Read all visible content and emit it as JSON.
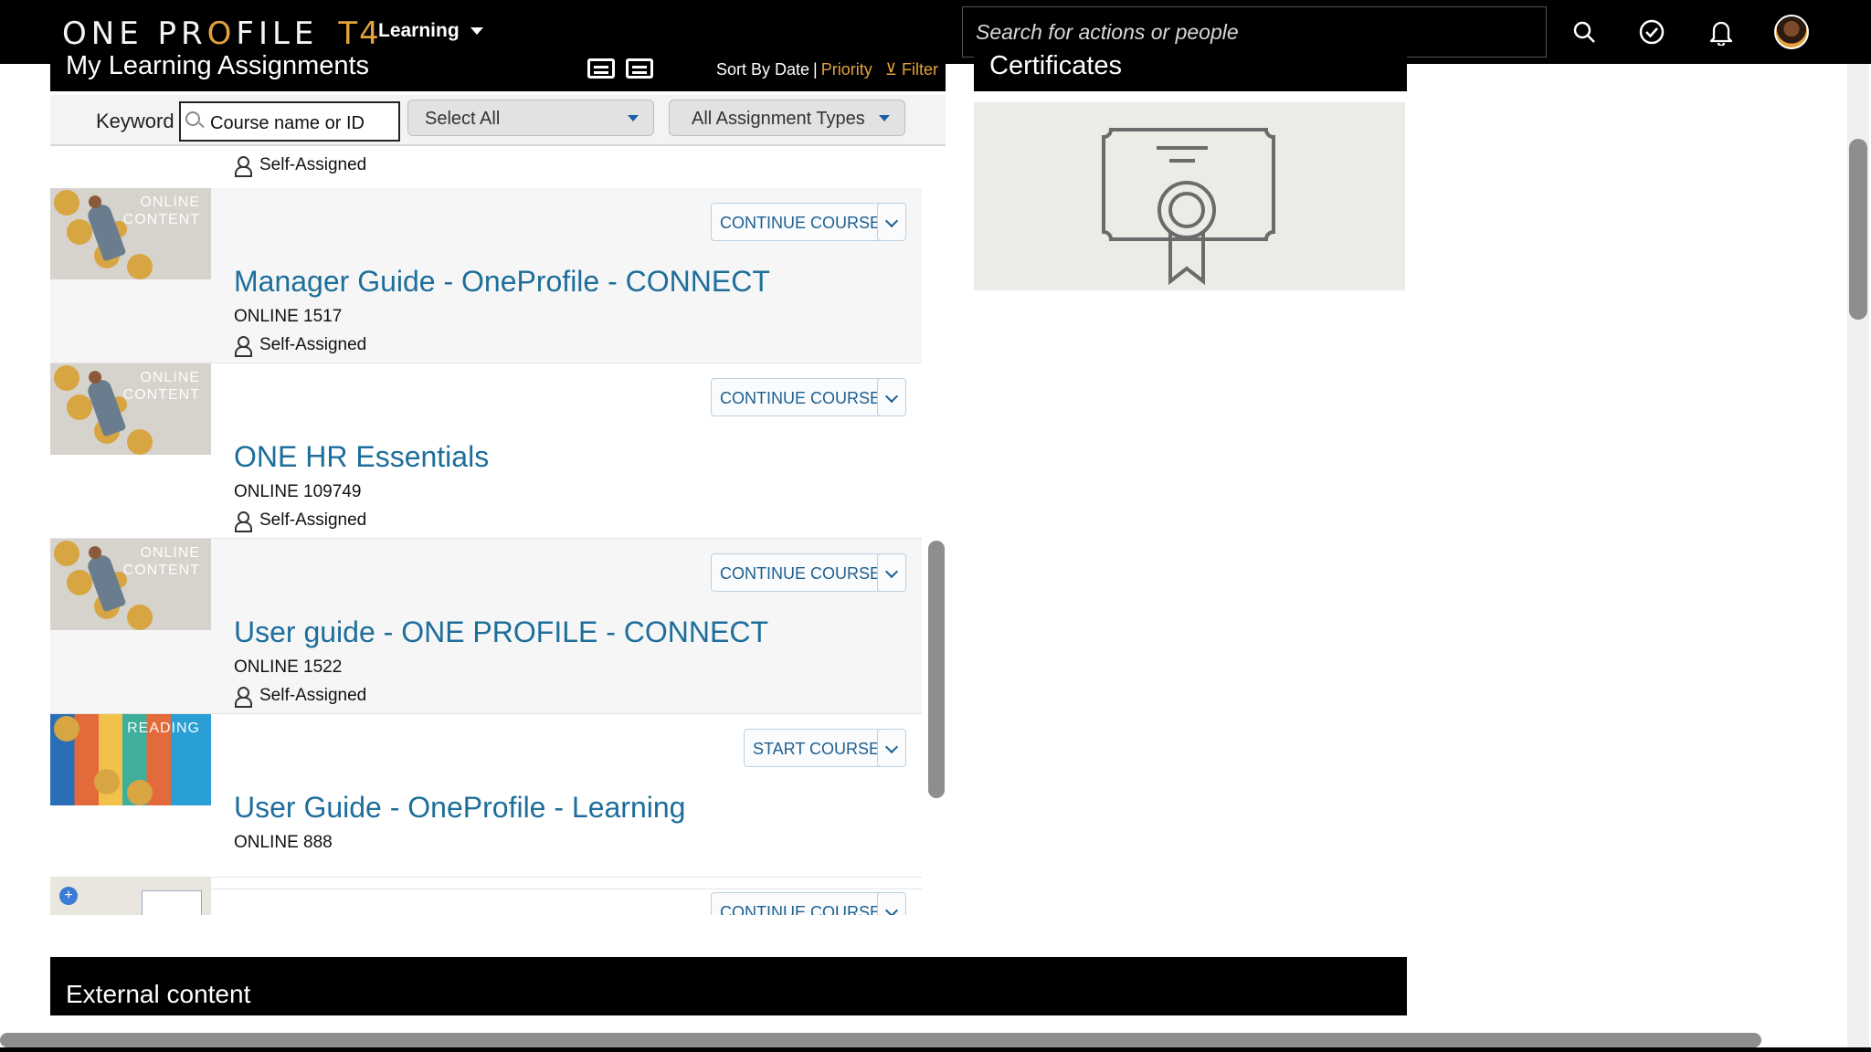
{
  "header": {
    "brand": {
      "part1": "ONE PR",
      "o_char": "O",
      "part2": "FILE",
      "version": "T4"
    },
    "module_label": "Learning",
    "search_placeholder": "Search for actions or people"
  },
  "assignments": {
    "title": "My Learning Assignments",
    "sort_label": "Sort By Date",
    "sort_separator": "|",
    "sort_priority": "Priority",
    "filter_label": "Filter",
    "keyword_label": "Keyword",
    "keyword_placeholder": "Course name or ID",
    "select_all": "Select All",
    "assignment_types": "All Assignment Types",
    "partial_top_assigned": "Self-Assigned",
    "courses": [
      {
        "thumb_label": "ONLINE\nCONTENT",
        "action": "CONTINUE COURSE",
        "title": "Manager Guide - OneProfile - CONNECT",
        "id": "ONLINE 1517",
        "assigned": "Self-Assigned"
      },
      {
        "thumb_label": "ONLINE\nCONTENT",
        "action": "CONTINUE COURSE",
        "title": "ONE HR Essentials",
        "id": "ONLINE 109749",
        "assigned": "Self-Assigned"
      },
      {
        "thumb_label": "ONLINE\nCONTENT",
        "action": "CONTINUE COURSE",
        "title": "User guide - ONE PROFILE - CONNECT",
        "id": "ONLINE 1522",
        "assigned": "Self-Assigned"
      },
      {
        "thumb_label": "READING",
        "action": "START COURSE",
        "title": "User Guide - OneProfile - Learning",
        "id": "ONLINE 888",
        "assigned": ""
      },
      {
        "thumb_label": "",
        "action": "CONTINUE COURSE",
        "title": "",
        "id": "",
        "assigned": ""
      }
    ]
  },
  "certificates": {
    "title": "Certificates"
  },
  "external_content": {
    "title": "External content"
  }
}
